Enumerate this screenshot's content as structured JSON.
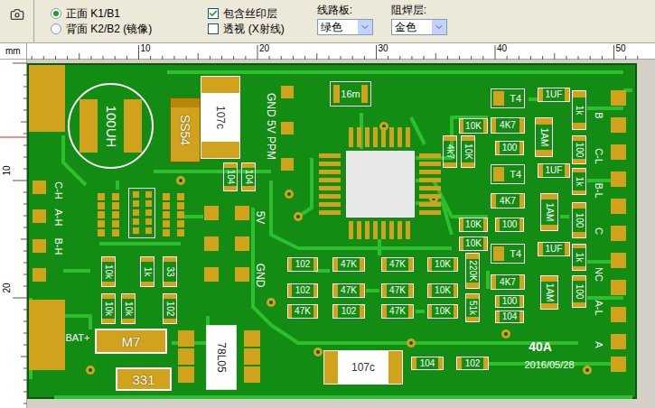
{
  "toolbar": {
    "view_options": [
      {
        "label": "正面 K1/B1",
        "selected": true
      },
      {
        "label": "背面 K2/B2 (镜像)",
        "selected": false
      }
    ],
    "layer_options": [
      {
        "label": "包含丝印层",
        "checked": true
      },
      {
        "label": "透视 (X射线)",
        "checked": false
      }
    ],
    "selects": [
      {
        "label": "线路板:",
        "value": "绿色"
      },
      {
        "label": "阻焊层:",
        "value": "金色"
      }
    ]
  },
  "ruler": {
    "unit": "mm",
    "top_ticks": [
      "10",
      "20",
      "30",
      "40",
      "50"
    ],
    "left_ticks": [
      "10",
      "20"
    ]
  },
  "board": {
    "components": [
      {
        "label": "100UH",
        "kind": "inductor"
      },
      {
        "label": "SS54",
        "kind": "diode"
      },
      {
        "label": "107c",
        "kind": "cap"
      },
      {
        "label": "104",
        "kind": "resistor-v"
      },
      {
        "label": "104",
        "kind": "resistor-v"
      },
      {
        "label": "16m",
        "kind": "crystal"
      },
      {
        "label": "T4",
        "kind": "transistor"
      },
      {
        "label": "1UF",
        "kind": "resistor"
      },
      {
        "label": "1k",
        "kind": "resistor-v"
      },
      {
        "label": "4K7",
        "kind": "resistor"
      },
      {
        "label": "10K",
        "kind": "resistor"
      },
      {
        "label": "100",
        "kind": "resistor"
      },
      {
        "label": "1AM",
        "kind": "resistor-v"
      },
      {
        "label": "100",
        "kind": "resistor-v"
      },
      {
        "label": "4k7",
        "kind": "resistor-v"
      },
      {
        "label": "10K",
        "kind": "resistor-v"
      },
      {
        "label": "T4",
        "kind": "transistor"
      },
      {
        "label": "1UF",
        "kind": "resistor"
      },
      {
        "label": "1k",
        "kind": "resistor-v"
      },
      {
        "label": "4K7",
        "kind": "resistor"
      },
      {
        "label": "1AM",
        "kind": "resistor-v"
      },
      {
        "label": "100",
        "kind": "resistor-v"
      },
      {
        "label": "10K",
        "kind": "resistor"
      },
      {
        "label": "100",
        "kind": "resistor"
      },
      {
        "label": "10K",
        "kind": "resistor"
      },
      {
        "label": "T4",
        "kind": "transistor"
      },
      {
        "label": "1UF",
        "kind": "resistor"
      },
      {
        "label": "1k",
        "kind": "resistor-v"
      },
      {
        "label": "220K",
        "kind": "resistor-v"
      },
      {
        "label": "51k",
        "kind": "resistor-v"
      },
      {
        "label": "4K7",
        "kind": "resistor"
      },
      {
        "label": "1AM",
        "kind": "resistor-v"
      },
      {
        "label": "100",
        "kind": "resistor-v"
      },
      {
        "label": "100",
        "kind": "resistor"
      },
      {
        "label": "104",
        "kind": "resistor"
      },
      {
        "label": "102",
        "kind": "resistor"
      },
      {
        "label": "47K",
        "kind": "resistor"
      },
      {
        "label": "47K",
        "kind": "resistor"
      },
      {
        "label": "10K",
        "kind": "resistor"
      },
      {
        "label": "102",
        "kind": "resistor"
      },
      {
        "label": "47K",
        "kind": "resistor"
      },
      {
        "label": "47K",
        "kind": "resistor"
      },
      {
        "label": "10K",
        "kind": "resistor"
      },
      {
        "label": "47K",
        "kind": "resistor"
      },
      {
        "label": "102",
        "kind": "resistor"
      },
      {
        "label": "47K",
        "kind": "resistor"
      },
      {
        "label": "10K",
        "kind": "resistor"
      },
      {
        "label": "10k",
        "kind": "resistor-v"
      },
      {
        "label": "1k",
        "kind": "resistor-v"
      },
      {
        "label": "33",
        "kind": "resistor-v"
      },
      {
        "label": "10k",
        "kind": "resistor-v"
      },
      {
        "label": "10k",
        "kind": "resistor-v"
      },
      {
        "label": "102",
        "kind": "resistor-v"
      },
      {
        "label": "M7",
        "kind": "module"
      },
      {
        "label": "331",
        "kind": "module"
      },
      {
        "label": "78L05",
        "kind": "regulator"
      },
      {
        "label": "107c",
        "kind": "cap-h"
      },
      {
        "label": "104",
        "kind": "resistor"
      },
      {
        "label": "102",
        "kind": "resistor"
      }
    ],
    "notes": [
      {
        "text": "GND 5V PPM",
        "kind": "vertical"
      },
      {
        "text": "5V",
        "kind": "vertical"
      },
      {
        "text": "GND",
        "kind": "vertical"
      },
      {
        "text": "BAT+",
        "kind": "horizontal"
      },
      {
        "text": "40A",
        "kind": "big"
      },
      {
        "text": "2016/05/28",
        "kind": "horizontal"
      }
    ],
    "pin_labels": [
      {
        "text": "B"
      },
      {
        "text": "C-L"
      },
      {
        "text": "B-L"
      },
      {
        "text": "C"
      },
      {
        "text": "NC"
      },
      {
        "text": "A-L"
      },
      {
        "text": "A"
      },
      {
        "text": "C-H"
      },
      {
        "text": "A-H"
      },
      {
        "text": "B-H"
      }
    ]
  }
}
